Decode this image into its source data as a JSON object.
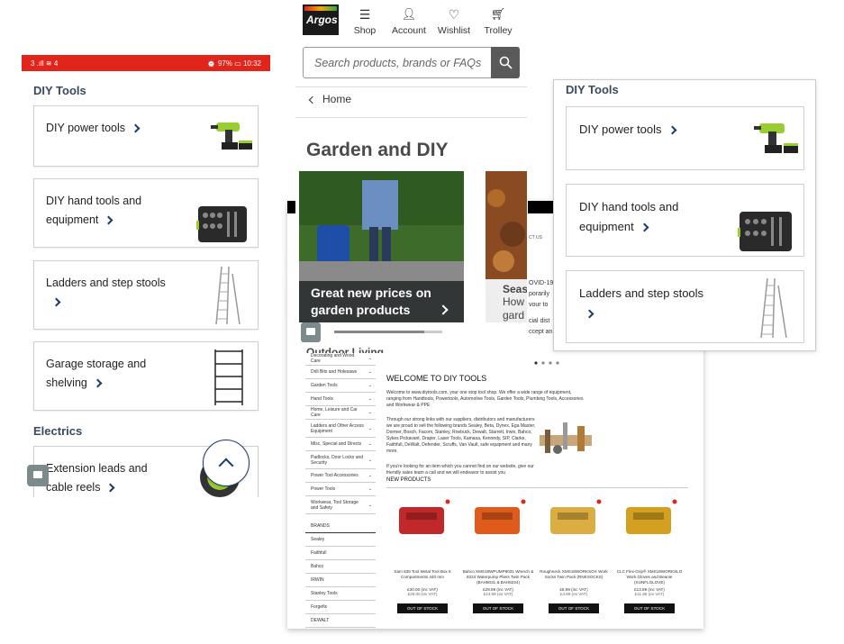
{
  "left": {
    "status_left": "3 .ıll ≋ 4",
    "status_right": "⏰ 97% ▭ 10:32",
    "section_diy": "DIY Tools",
    "section_electrics": "Electrics",
    "cards": [
      {
        "label": "DIY power tools"
      },
      {
        "label": "DIY hand tools and equipment"
      },
      {
        "label": "Ladders and step stools"
      },
      {
        "label": "Garage storage and shelving"
      },
      {
        "label": "Extension leads and cable reels"
      }
    ]
  },
  "argos": {
    "logo": "Argos",
    "nav": [
      "Shop",
      "Account",
      "Wishlist",
      "Trolley"
    ],
    "search_placeholder": "Search products, brands or FAQs",
    "breadcrumb": "Home",
    "page_title": "Garden and DIY",
    "promo1": "Great new prices on garden products",
    "promo2_title": "Seas",
    "promo2_sub": "How gard",
    "subheading": "Outdoor Living"
  },
  "diy_site": {
    "welcome": "WELCOME TO DIY TOOLS",
    "intro": "Welcome to www.diytools.com, your one stop tool shop. We offer a wide range of equipment, ranging from Handtools, Powertools, Automotive Tools, Garden Tools, Plumbing Tools, Accessories and Workwear & PPE",
    "brands_text": "Through our strong links with our suppliers, distributors and manufacturers we are proud to sell the following brands Sealey, Beta, Dynex, Ega Master, Dormer, Bosch, Facom, Stanley, Roebuck, Dewalt, Starrett, Irwin, Bahco, Sykes Pickavant, Draper, Laser Tools, Kamasa, Kennedy, SIP, Clarke, Faithfull, DeWalt, Defender, Scruffs, Van Vault, safe equipment and many more.",
    "contact_text": "If you're looking for an item which you cannot find on our website, give our friendly sales team a call and we will endeavor to assist you",
    "new_products": "NEW PRODUCTS",
    "covid_text": "OVID-19",
    "covid2": "porarily",
    "covid3": "vour to",
    "covid4": "cial dist",
    "covid5": "ccept an",
    "contact_us": "CT US",
    "menu": [
      "Decorating and Wood Care",
      "Drill Bits and Holesaws",
      "Garden Tools",
      "Hand Tools",
      "Home, Leisure and Car Care",
      "Ladders and Other Access Equipment",
      "Misc, Special and Directs",
      "Padlocks, Door Locks and Security",
      "Power Tool Accessories",
      "Power Tools",
      "Workwear, Tool Storage and Safety"
    ],
    "brands_heading": "BRANDS",
    "brands": [
      "Sealey",
      "Faithfull",
      "Bahco",
      "IRWIN",
      "Stanley Tools",
      "Forgefix",
      "DEWALT"
    ],
    "products": [
      {
        "name": "Sam 635 Tool Metal Tool Box 6 Compartments 440 mm",
        "price": "£30.00 (inc VAT)",
        "ex": "£25.00 (ex VAT)",
        "status": "OUT OF STOCK"
      },
      {
        "name": "Bahco XMS18WPUMP8031 Wrench & 8224 Waterpump Pliers Twin Pack (BAH8031 & BAH8224)",
        "price": "£29.99 (inc VAT)",
        "ex": "£24.99 (ex VAT)",
        "status": "OUT OF STOCK"
      },
      {
        "name": "Roughneck XMS18WORKSOX Work Socks Twin Pack (RNKSOCKS)",
        "price": "£5.99 (inc VAT)",
        "ex": "£4.99 (ex VAT)",
        "status": "OUT OF STOCK"
      },
      {
        "name": "CLC Flex-Grip® XMS18WORKSLO Work Gloves and Beanie (XUNFLGLOVE)",
        "price": "£13.99 (inc VAT)",
        "ex": "£11.66 (ex VAT)",
        "status": "OUT OF STOCK"
      }
    ]
  },
  "right": {
    "section": "DIY Tools",
    "cards": [
      {
        "label": "DIY power tools"
      },
      {
        "label": "DIY hand tools and equipment"
      },
      {
        "label": "Ladders and step stools"
      }
    ]
  },
  "colors": {
    "accent": "#e1251b",
    "navy": "#1a3a6e",
    "heading": "#3a4a5f"
  }
}
